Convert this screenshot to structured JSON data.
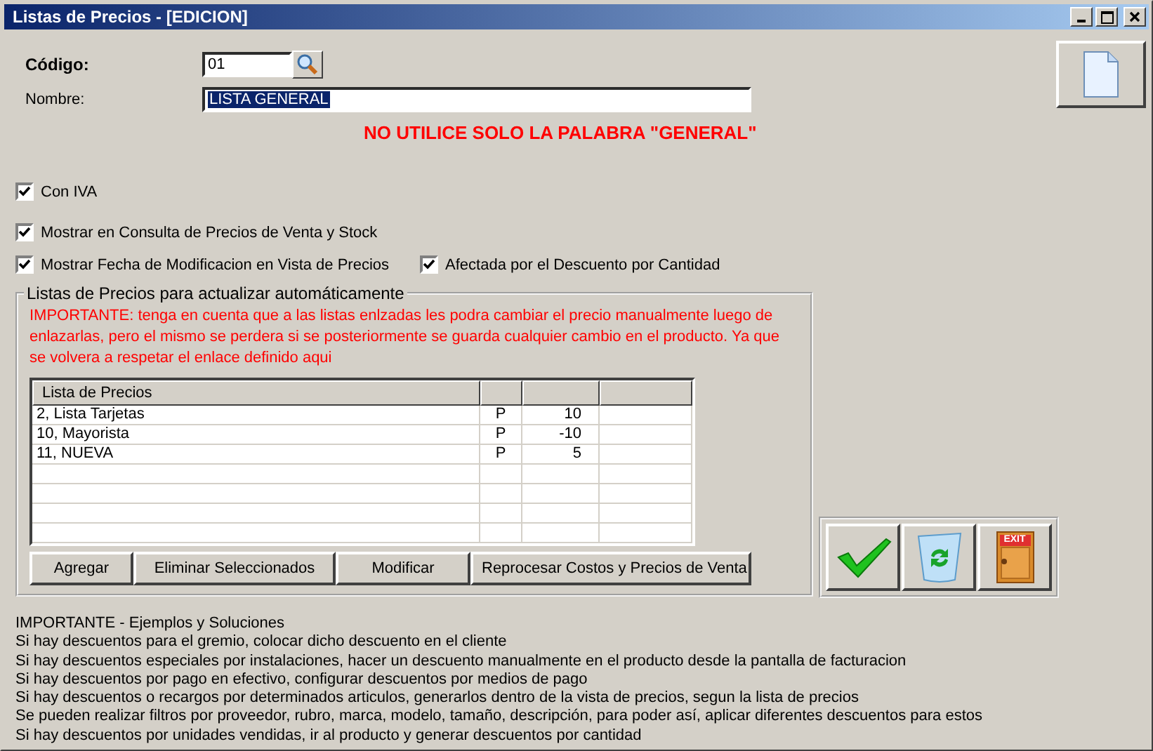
{
  "window": {
    "title": "Listas de Precios - [EDICION]"
  },
  "codigo": {
    "label": "Código:",
    "value": "01"
  },
  "nombre": {
    "label": "Nombre:",
    "value": "LISTA GENERAL",
    "highlighted": true
  },
  "warning": "NO UTILICE SOLO LA PALABRA \"GENERAL\"",
  "checkbox_rows": [
    [
      {
        "label": "Con IVA",
        "checked": true
      }
    ],
    [
      {
        "label": "Mostrar en Consulta de Precios de Venta y Stock",
        "checked": true
      }
    ],
    [
      {
        "label": "Mostrar Fecha de Modificacion en Vista de Precios",
        "checked": true
      },
      {
        "label": "Afectada por el Descuento por Cantidad",
        "checked": true
      }
    ]
  ],
  "group": {
    "title": "Listas de Precios para actualizar automáticamente",
    "note": "IMPORTANTE: tenga en cuenta que a las listas enlzadas les podra cambiar el precio manualmente luego de enlazarlas, pero el mismo se perdera si se posteriormente se guarda cualquier cambio en el producto. Ya que se volvera a respetar el enlace definido aqui",
    "table": {
      "columns": [
        "Lista de Precios"
      ],
      "rows": [
        {
          "cells": [
            "2, Lista Tarjetas",
            "P",
            "10"
          ]
        },
        {
          "cells": [
            "10, Mayorista",
            "P",
            "-10"
          ]
        },
        {
          "cells": [
            "11, NUEVA",
            "P",
            "5"
          ]
        }
      ]
    },
    "buttons": [
      "Agregar",
      "Eliminar Seleccionados",
      "Modificar",
      "Reprocesar Costos y Precios de Venta"
    ]
  },
  "action_buttons": [
    {
      "kind": "accept"
    },
    {
      "kind": "recycle"
    },
    {
      "kind": "exit",
      "label": "EXIT"
    }
  ],
  "notes": {
    "title": "IMPORTANTE - Ejemplos y Soluciones",
    "lines": [
      "Si hay descuentos para el gremio, colocar dicho descuento en el cliente",
      "Si hay descuentos especiales por instalaciones, hacer un descuento manualmente en el producto desde la pantalla de facturacion",
      "Si hay descuentos por pago en efectivo, configurar descuentos por medios de pago",
      "Si hay descuentos o recargos por determinados articulos, generarlos dentro de la vista de precios, segun la lista de precios",
      "Se pueden realizar filtros por proveedor, rubro, marca, modelo, tamaño, descripción, para poder así, aplicar diferentes descuentos para estos",
      "Si hay descuentos por unidades vendidas, ir al producto y generar descuentos por cantidad"
    ]
  }
}
